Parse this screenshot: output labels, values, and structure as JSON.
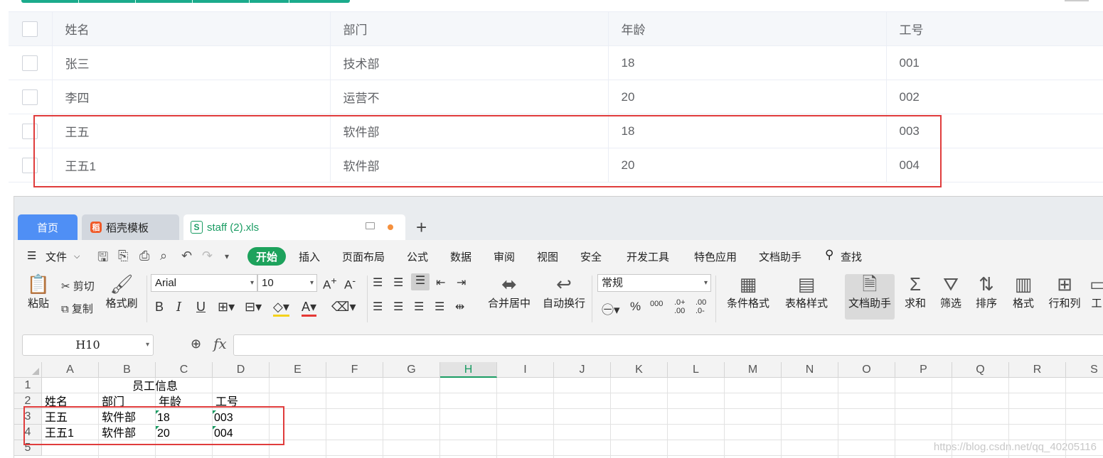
{
  "web_table": {
    "headers": [
      "姓名",
      "部门",
      "年龄",
      "工号"
    ],
    "rows": [
      [
        "张三",
        "技术部",
        "18",
        "001"
      ],
      [
        "李四",
        "运营不",
        "20",
        "002"
      ],
      [
        "王五",
        "软件部",
        "18",
        "003"
      ],
      [
        "王五1",
        "软件部",
        "20",
        "004"
      ]
    ]
  },
  "wps": {
    "tabs": {
      "home": "首页",
      "template": "稻壳模板",
      "file": "staff (2).xls",
      "add": "+"
    },
    "menu": {
      "file": "文件",
      "items": [
        "开始",
        "插入",
        "页面布局",
        "公式",
        "数据",
        "审阅",
        "视图",
        "安全",
        "开发工具",
        "特色应用",
        "文档助手"
      ],
      "search": "查找"
    },
    "ribbon": {
      "paste": "粘贴",
      "cut": "剪切",
      "copy": "复制",
      "format_painter": "格式刷",
      "font": "Arial",
      "size": "10",
      "merge": "合并居中",
      "wrap": "自动换行",
      "number_format": "常规",
      "cond_format": "条件格式",
      "table_style": "表格样式",
      "doc_helper": "文档助手",
      "sum": "求和",
      "filter": "筛选",
      "sort": "排序",
      "format": "格式",
      "rowcol": "行和列",
      "work": "工"
    },
    "formula_bar": {
      "cell_ref": "H10",
      "fx": "fx",
      "value": ""
    },
    "columns": [
      "A",
      "B",
      "C",
      "D",
      "E",
      "F",
      "G",
      "H",
      "I",
      "J",
      "K",
      "L",
      "M",
      "N",
      "O",
      "P",
      "Q",
      "R",
      "S"
    ],
    "selected_column": "H",
    "rows": [
      "1",
      "2",
      "3",
      "4",
      "5"
    ],
    "cells": {
      "title": "员工信息",
      "header": [
        "姓名",
        "部门",
        "年龄",
        "工号"
      ],
      "r3": [
        "王五",
        "软件部",
        "18",
        "003"
      ],
      "r4": [
        "王五1",
        "软件部",
        "20",
        "004"
      ]
    }
  },
  "watermark": "https://blog.csdn.net/qq_40205116"
}
